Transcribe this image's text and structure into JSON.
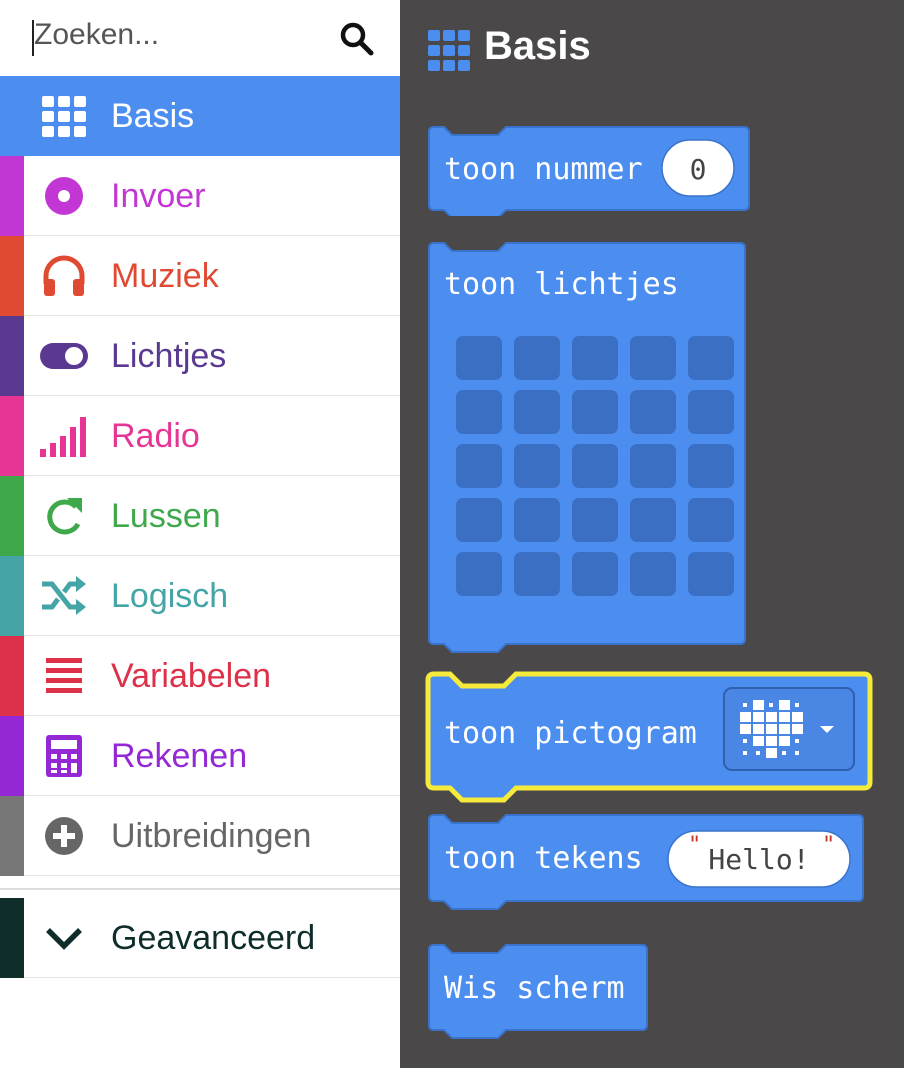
{
  "search": {
    "placeholder": "Zoeken..."
  },
  "categories": [
    {
      "label": "Basis",
      "icon": "grid-icon",
      "color": "#4c8ef0",
      "selected": true
    },
    {
      "label": "Invoer",
      "icon": "input-circle-icon",
      "color": "#c237d4"
    },
    {
      "label": "Muziek",
      "icon": "headphones-icon",
      "color": "#e04a32"
    },
    {
      "label": "Lichtjes",
      "icon": "toggle-icon",
      "color": "#5a3a90"
    },
    {
      "label": "Radio",
      "icon": "signal-bars-icon",
      "color": "#e63595"
    },
    {
      "label": "Lussen",
      "icon": "refresh-icon",
      "color": "#3ea84a"
    },
    {
      "label": "Logisch",
      "icon": "shuffle-icon",
      "color": "#45a5a6"
    },
    {
      "label": "Variabelen",
      "icon": "list-lines-icon",
      "color": "#dc3148"
    },
    {
      "label": "Rekenen",
      "icon": "calculator-icon",
      "color": "#9428d4"
    },
    {
      "label": "Uitbreidingen",
      "icon": "plus-circle-icon",
      "color": "#777777"
    },
    {
      "label": "Geavanceerd",
      "icon": "chevron-down-icon",
      "color": "#0f2d2b"
    }
  ],
  "flyout": {
    "title": "Basis",
    "blocks": {
      "show_number": {
        "text": "toon nummer",
        "value": "0"
      },
      "show_leds": {
        "text": "toon lichtjes"
      },
      "show_icon": {
        "text": "toon pictogram"
      },
      "show_string": {
        "text": "toon tekens",
        "value": "Hello!"
      },
      "clear_screen": {
        "text": "Wis scherm"
      }
    }
  },
  "colors": {
    "block": "#4c8ef0",
    "block_border": "#3a73cc",
    "led_off": "#3a6fc4",
    "highlight": "#f6ea3b",
    "flyout_bg": "#4a4849"
  }
}
